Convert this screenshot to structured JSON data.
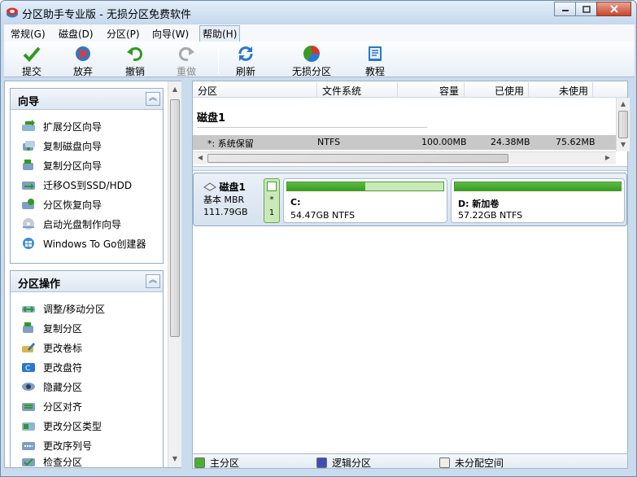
{
  "window": {
    "title": "分区助手专业版 - 无损分区免费软件"
  },
  "menu": [
    {
      "label": "常规(G)"
    },
    {
      "label": "磁盘(D)"
    },
    {
      "label": "分区(P)"
    },
    {
      "label": "向导(W)"
    },
    {
      "label": "帮助(H)",
      "active": true
    }
  ],
  "toolbar": {
    "commit": "提交",
    "discard": "放弃",
    "undo": "撤销",
    "redo": "重做",
    "refresh": "刷新",
    "lossless": "无损分区",
    "tutorial": "教程"
  },
  "wizard_panel": {
    "title": "向导",
    "items": [
      "扩展分区向导",
      "复制磁盘向导",
      "复制分区向导",
      "迁移OS到SSD/HDD",
      "分区恢复向导",
      "启动光盘制作向导",
      "Windows To Go创建器"
    ]
  },
  "ops_panel": {
    "title": "分区操作",
    "items": [
      "调整/移动分区",
      "复制分区",
      "更改卷标",
      "更改盘符",
      "隐藏分区",
      "分区对齐",
      "更改分区类型",
      "更改序列号",
      "检查分区"
    ]
  },
  "list": {
    "headers": [
      "分区",
      "文件系统",
      "容量",
      "已使用",
      "未使用"
    ],
    "disk_label": "磁盘1",
    "rows": [
      {
        "partition": "*: 系统保留",
        "fs": "NTFS",
        "capacity": "100.00MB",
        "used": "24.38MB",
        "free": "75.62MB"
      }
    ]
  },
  "diskmap": {
    "disk_name": "磁盘1",
    "disk_type": "基本 MBR",
    "disk_size": "111.79GB",
    "small_label": "*",
    "small_num": "1",
    "partitions": [
      {
        "label": "C:",
        "size": "54.47GB NTFS",
        "used_fraction": 0.5
      },
      {
        "label": "D: 新加卷",
        "size": "57.22GB NTFS",
        "used_fraction": 1.0
      }
    ]
  },
  "legend": {
    "primary": "主分区",
    "logical": "逻辑分区",
    "unallocated": "未分配空间"
  },
  "colors": {
    "primary": "#4caf2e",
    "logical": "#3d4fb5",
    "unallocated": "#f0ede4",
    "accent": "#c9dcee"
  }
}
